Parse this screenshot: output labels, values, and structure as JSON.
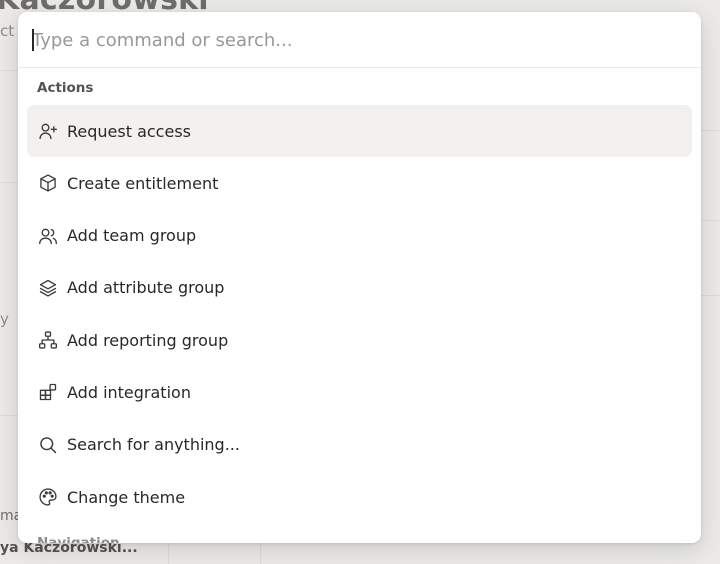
{
  "background": {
    "title_fragment": "Kaczorowski",
    "ct_fragment": "ct",
    "y_fragment": "y",
    "may_fragment": "may",
    "user_fragment": "ya Kaczorowski..."
  },
  "search": {
    "placeholder": "Type a command or search...",
    "value": ""
  },
  "sections": {
    "actions": "Actions",
    "navigation": "Navigation"
  },
  "items": [
    {
      "label": "Request access",
      "icon": "user-plus-icon"
    },
    {
      "label": "Create entitlement",
      "icon": "box-icon"
    },
    {
      "label": "Add team group",
      "icon": "users-icon"
    },
    {
      "label": "Add attribute group",
      "icon": "layers-icon"
    },
    {
      "label": "Add reporting group",
      "icon": "org-chart-icon"
    },
    {
      "label": "Add integration",
      "icon": "blocks-icon"
    },
    {
      "label": "Search for anything...",
      "icon": "search-icon"
    },
    {
      "label": "Change theme",
      "icon": "palette-icon"
    }
  ]
}
